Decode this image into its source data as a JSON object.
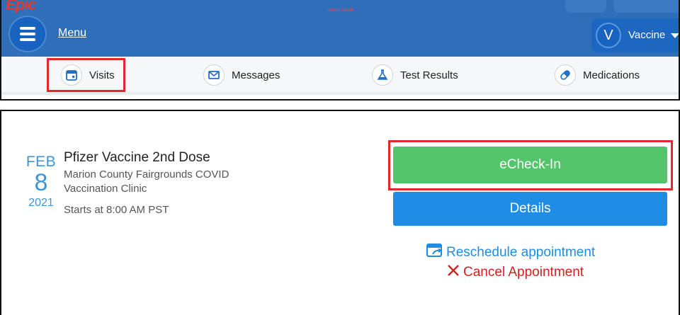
{
  "header": {
    "logo": "Epic",
    "org": "Salem Health",
    "menu_label": "Menu",
    "account_initial": "V",
    "account_name": "Vaccine"
  },
  "nav": {
    "items": [
      {
        "label": "Visits",
        "icon": "calendar-icon"
      },
      {
        "label": "Messages",
        "icon": "envelope-icon"
      },
      {
        "label": "Test Results",
        "icon": "flask-icon"
      },
      {
        "label": "Medications",
        "icon": "pill-icon"
      }
    ]
  },
  "appointment": {
    "month": "FEB",
    "day": "8",
    "year": "2021",
    "title": "Pfizer Vaccine 2nd Dose",
    "location": "Marion County Fairgrounds COVID Vaccination Clinic",
    "time": "Starts at 8:00 AM PST",
    "echeckin_label": "eCheck-In",
    "details_label": "Details",
    "reschedule_label": "Reschedule appointment",
    "cancel_label": "Cancel Appointment"
  },
  "colors": {
    "header_blue": "#2f6eb9",
    "date_blue": "#3c95d8",
    "echeck_green": "#52c56b",
    "details_blue": "#1f8ce6",
    "highlight_red": "#e0282e",
    "cancel_red": "#d42020"
  }
}
